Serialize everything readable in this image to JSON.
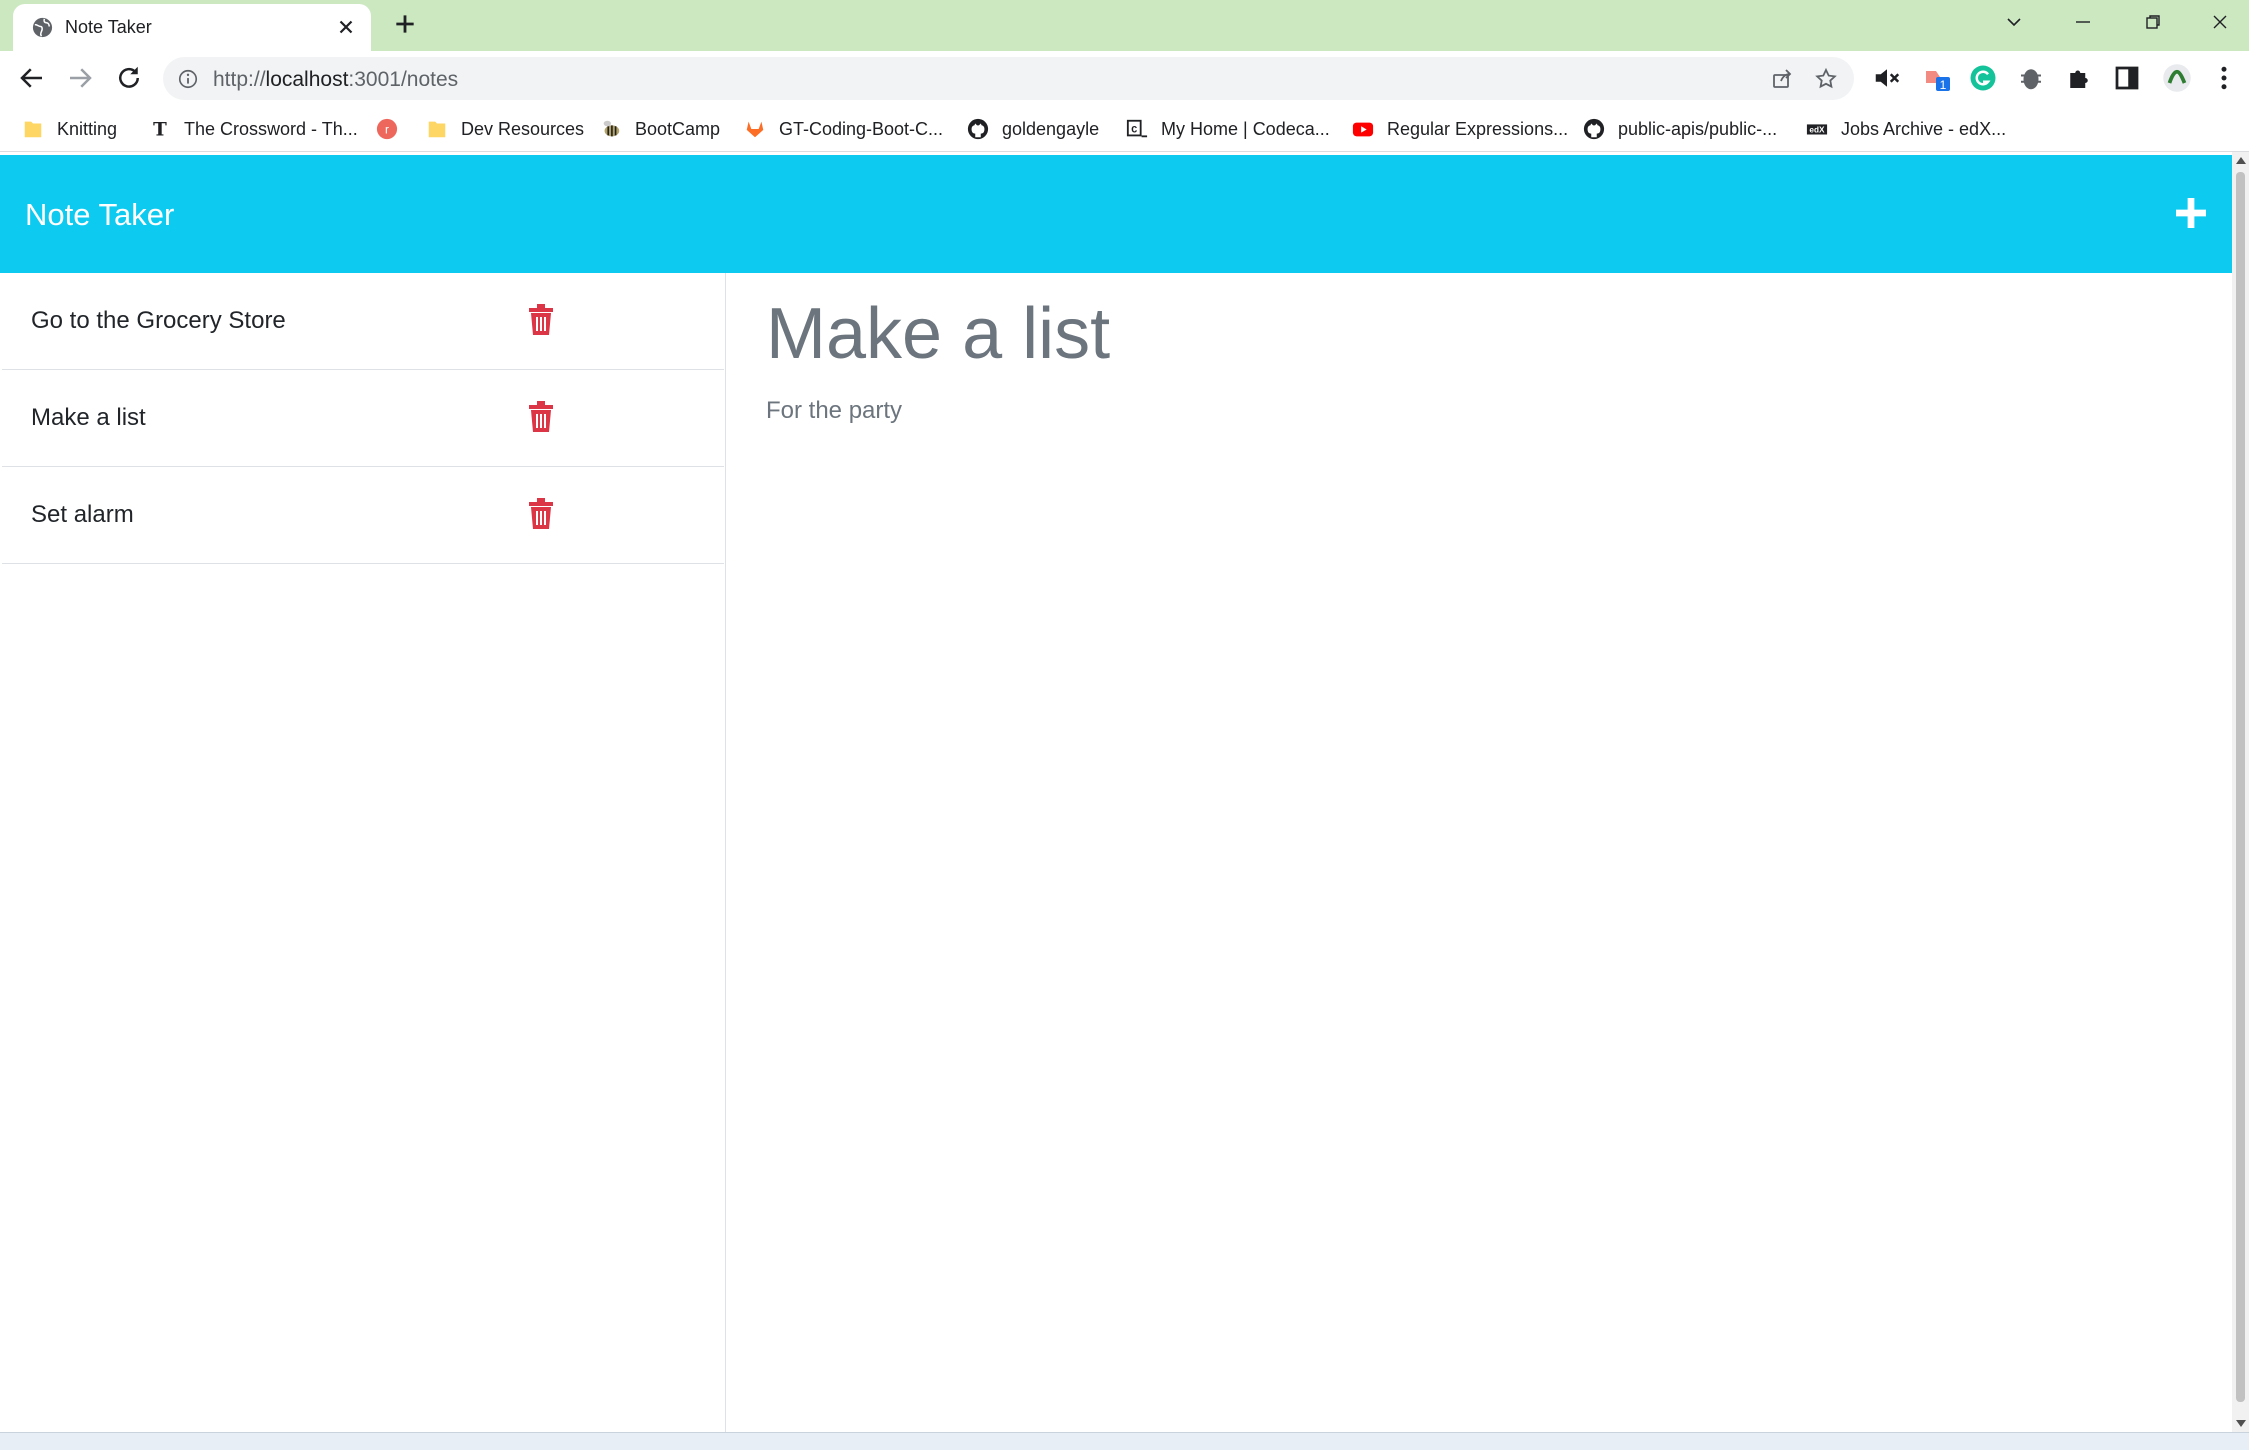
{
  "browser": {
    "tab": {
      "title": "Note Taker",
      "favicon": "globe-icon"
    },
    "url": {
      "scheme": "http://",
      "host": "localhost",
      "path": ":3001/notes"
    },
    "bookmarks": [
      {
        "label": "Knitting",
        "icon": "folder-icon"
      },
      {
        "label": "The Crossword - Th...",
        "icon": "nyt-icon"
      },
      {
        "label": "",
        "icon": "red-circle-icon"
      },
      {
        "label": "Dev Resources",
        "icon": "folder-icon"
      },
      {
        "label": "BootCamp",
        "icon": "bee-icon"
      },
      {
        "label": "GT-Coding-Boot-C...",
        "icon": "gitlab-icon"
      },
      {
        "label": "goldengayle",
        "icon": "github-icon"
      },
      {
        "label": "My Home | Codeca...",
        "icon": "codecademy-icon"
      },
      {
        "label": "Regular Expressions...",
        "icon": "youtube-icon"
      },
      {
        "label": "public-apis/public-...",
        "icon": "github-icon"
      },
      {
        "label": "Jobs Archive - edX...",
        "icon": "edx-icon"
      }
    ],
    "extension_badge": "1"
  },
  "app": {
    "brand": "Note Taker",
    "add_button_icon": "plus-icon",
    "colors": {
      "navbar": "#0dcaf0",
      "trash": "#dc3545",
      "muted_text": "#6c757d"
    },
    "notes": [
      {
        "title": "Go to the Grocery Store"
      },
      {
        "title": "Make a list"
      },
      {
        "title": "Set alarm"
      }
    ],
    "active_note": {
      "title": "Make a list",
      "text": "For the party"
    }
  }
}
